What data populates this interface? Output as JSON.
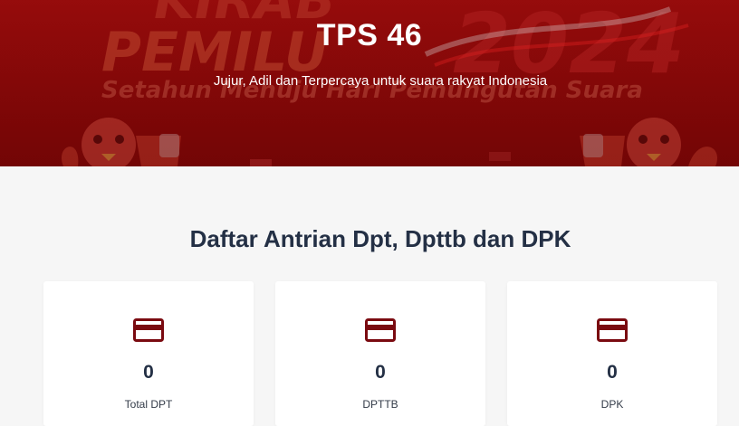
{
  "hero": {
    "title": "TPS 46",
    "subtitle": "Jujur, Adil dan Terpercaya untuk suara rakyat Indonesia",
    "banner_text_large": "KIRAB PEMILU",
    "banner_year": "2024",
    "banner_tagline": "Setahun Menuju Hari Pemungutan Suara",
    "bg_color": "#8f0808"
  },
  "section": {
    "title": "Daftar Antrian Dpt, Dpttb dan DPK"
  },
  "cards": [
    {
      "icon": "card-icon",
      "value": "0",
      "label": "Total DPT"
    },
    {
      "icon": "card-icon",
      "value": "0",
      "label": "DPTTB"
    },
    {
      "icon": "card-icon",
      "value": "0",
      "label": "DPK"
    }
  ],
  "colors": {
    "accent": "#7a0a10",
    "text_dark": "#243045",
    "page_bg": "#f6f6f6"
  }
}
